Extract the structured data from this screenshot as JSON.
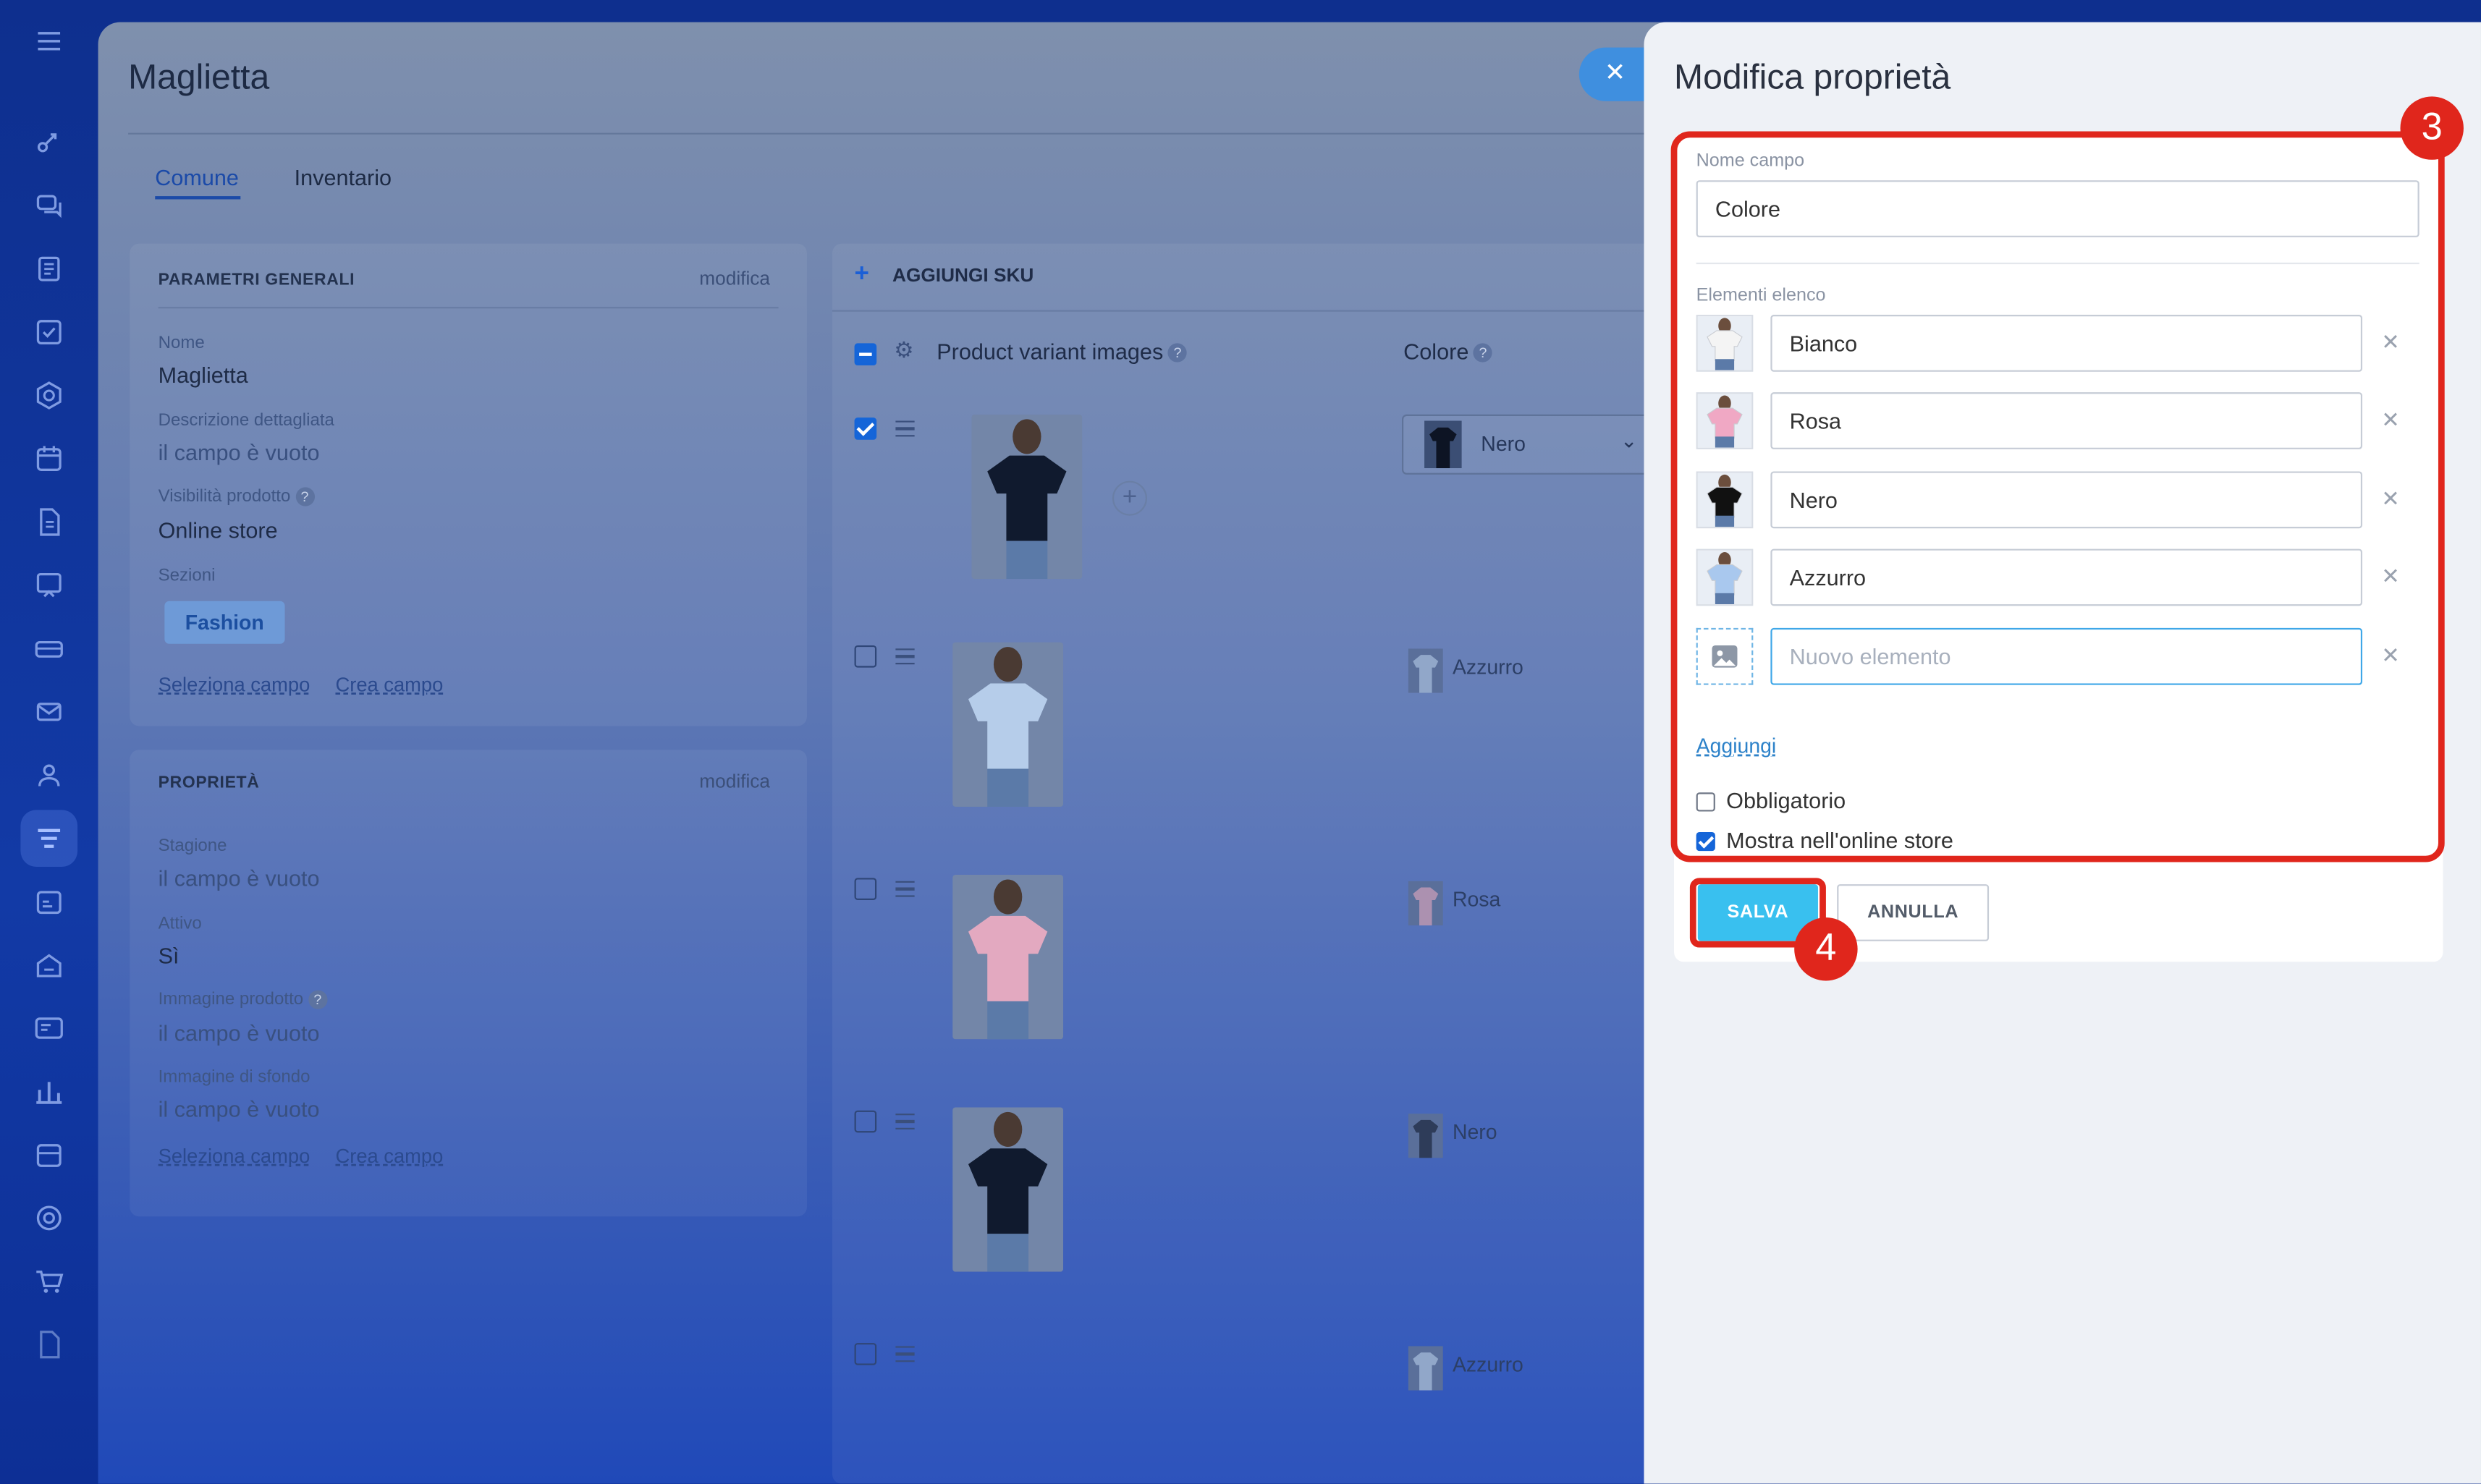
{
  "rail": {
    "icons": [
      "menu-icon",
      "funnel-icon",
      "chat-icon",
      "news-icon",
      "tasks-icon",
      "sites-icon",
      "calendar-icon",
      "documents-icon",
      "presentation-icon",
      "terminal-icon",
      "mail-icon",
      "contacts-icon",
      "crm-icon",
      "booking-icon",
      "inventory-icon",
      "id-card-icon",
      "analytics-icon",
      "warehouse-icon",
      "marketing-icon",
      "shop-icon",
      "pages-icon"
    ],
    "active": "crm-icon"
  },
  "product": {
    "title": "Maglietta",
    "tabs": [
      "Comune",
      "Inventario"
    ],
    "active_tab": "Comune",
    "general": {
      "title": "PARAMETRI GENERALI",
      "edit": "modifica",
      "fields": [
        {
          "label": "Nome",
          "value": "Maglietta"
        },
        {
          "label": "Descrizione dettagliata",
          "value": "il campo è vuoto"
        },
        {
          "label": "Visibilità prodotto",
          "value": "Online store"
        },
        {
          "label": "Sezioni",
          "value": ""
        }
      ],
      "section_chip": "Fashion",
      "select_field": "Seleziona campo",
      "create_field": "Crea campo"
    },
    "properties": {
      "title": "PROPRIETÀ",
      "edit": "modifica",
      "fields": [
        {
          "label": "Stagione",
          "value": "il campo è vuoto"
        },
        {
          "label": "Attivo",
          "value": "Sì"
        },
        {
          "label": "Immagine prodotto",
          "value": "il campo è vuoto"
        },
        {
          "label": "Immagine di sfondo",
          "value": "il campo è vuoto"
        }
      ],
      "select_field": "Seleziona campo",
      "create_field": "Crea campo"
    },
    "sku": {
      "add_label": "AGGIUNGI SKU",
      "col_images": "Product variant images",
      "col_color": "Colore",
      "rows": [
        {
          "checked": true,
          "color": "Nero",
          "shirt": "#101a2e"
        },
        {
          "checked": false,
          "color": "Azzurro",
          "shirt": "#b6cdea"
        },
        {
          "checked": false,
          "color": "Rosa",
          "shirt": "#e3a9c0"
        },
        {
          "checked": false,
          "color": "Nero",
          "shirt": "#101a2e"
        },
        {
          "checked": false,
          "color": "Azzurro",
          "shirt": "#b6cdea"
        }
      ]
    }
  },
  "panel": {
    "title": "Modifica proprietà",
    "field_name_label": "Nome campo",
    "field_name_value": "Colore",
    "list_label": "Elementi elenco",
    "items": [
      {
        "value": "Bianco",
        "shirt": "#f4f4f4"
      },
      {
        "value": "Rosa",
        "shirt": "#f0a8c4"
      },
      {
        "value": "Nero",
        "shirt": "#111111"
      },
      {
        "value": "Azzurro",
        "shirt": "#a9c8ee"
      }
    ],
    "new_item_placeholder": "Nuovo elemento",
    "add_link": "Aggiungi",
    "required_label": "Obbligatorio",
    "required_checked": false,
    "show_store_label": "Mostra nell'online store",
    "show_store_checked": true,
    "save": "SALVA",
    "cancel": "ANNULLA"
  },
  "annotations": {
    "step_fields": "3",
    "step_save": "4",
    "color": "#e0261c"
  }
}
